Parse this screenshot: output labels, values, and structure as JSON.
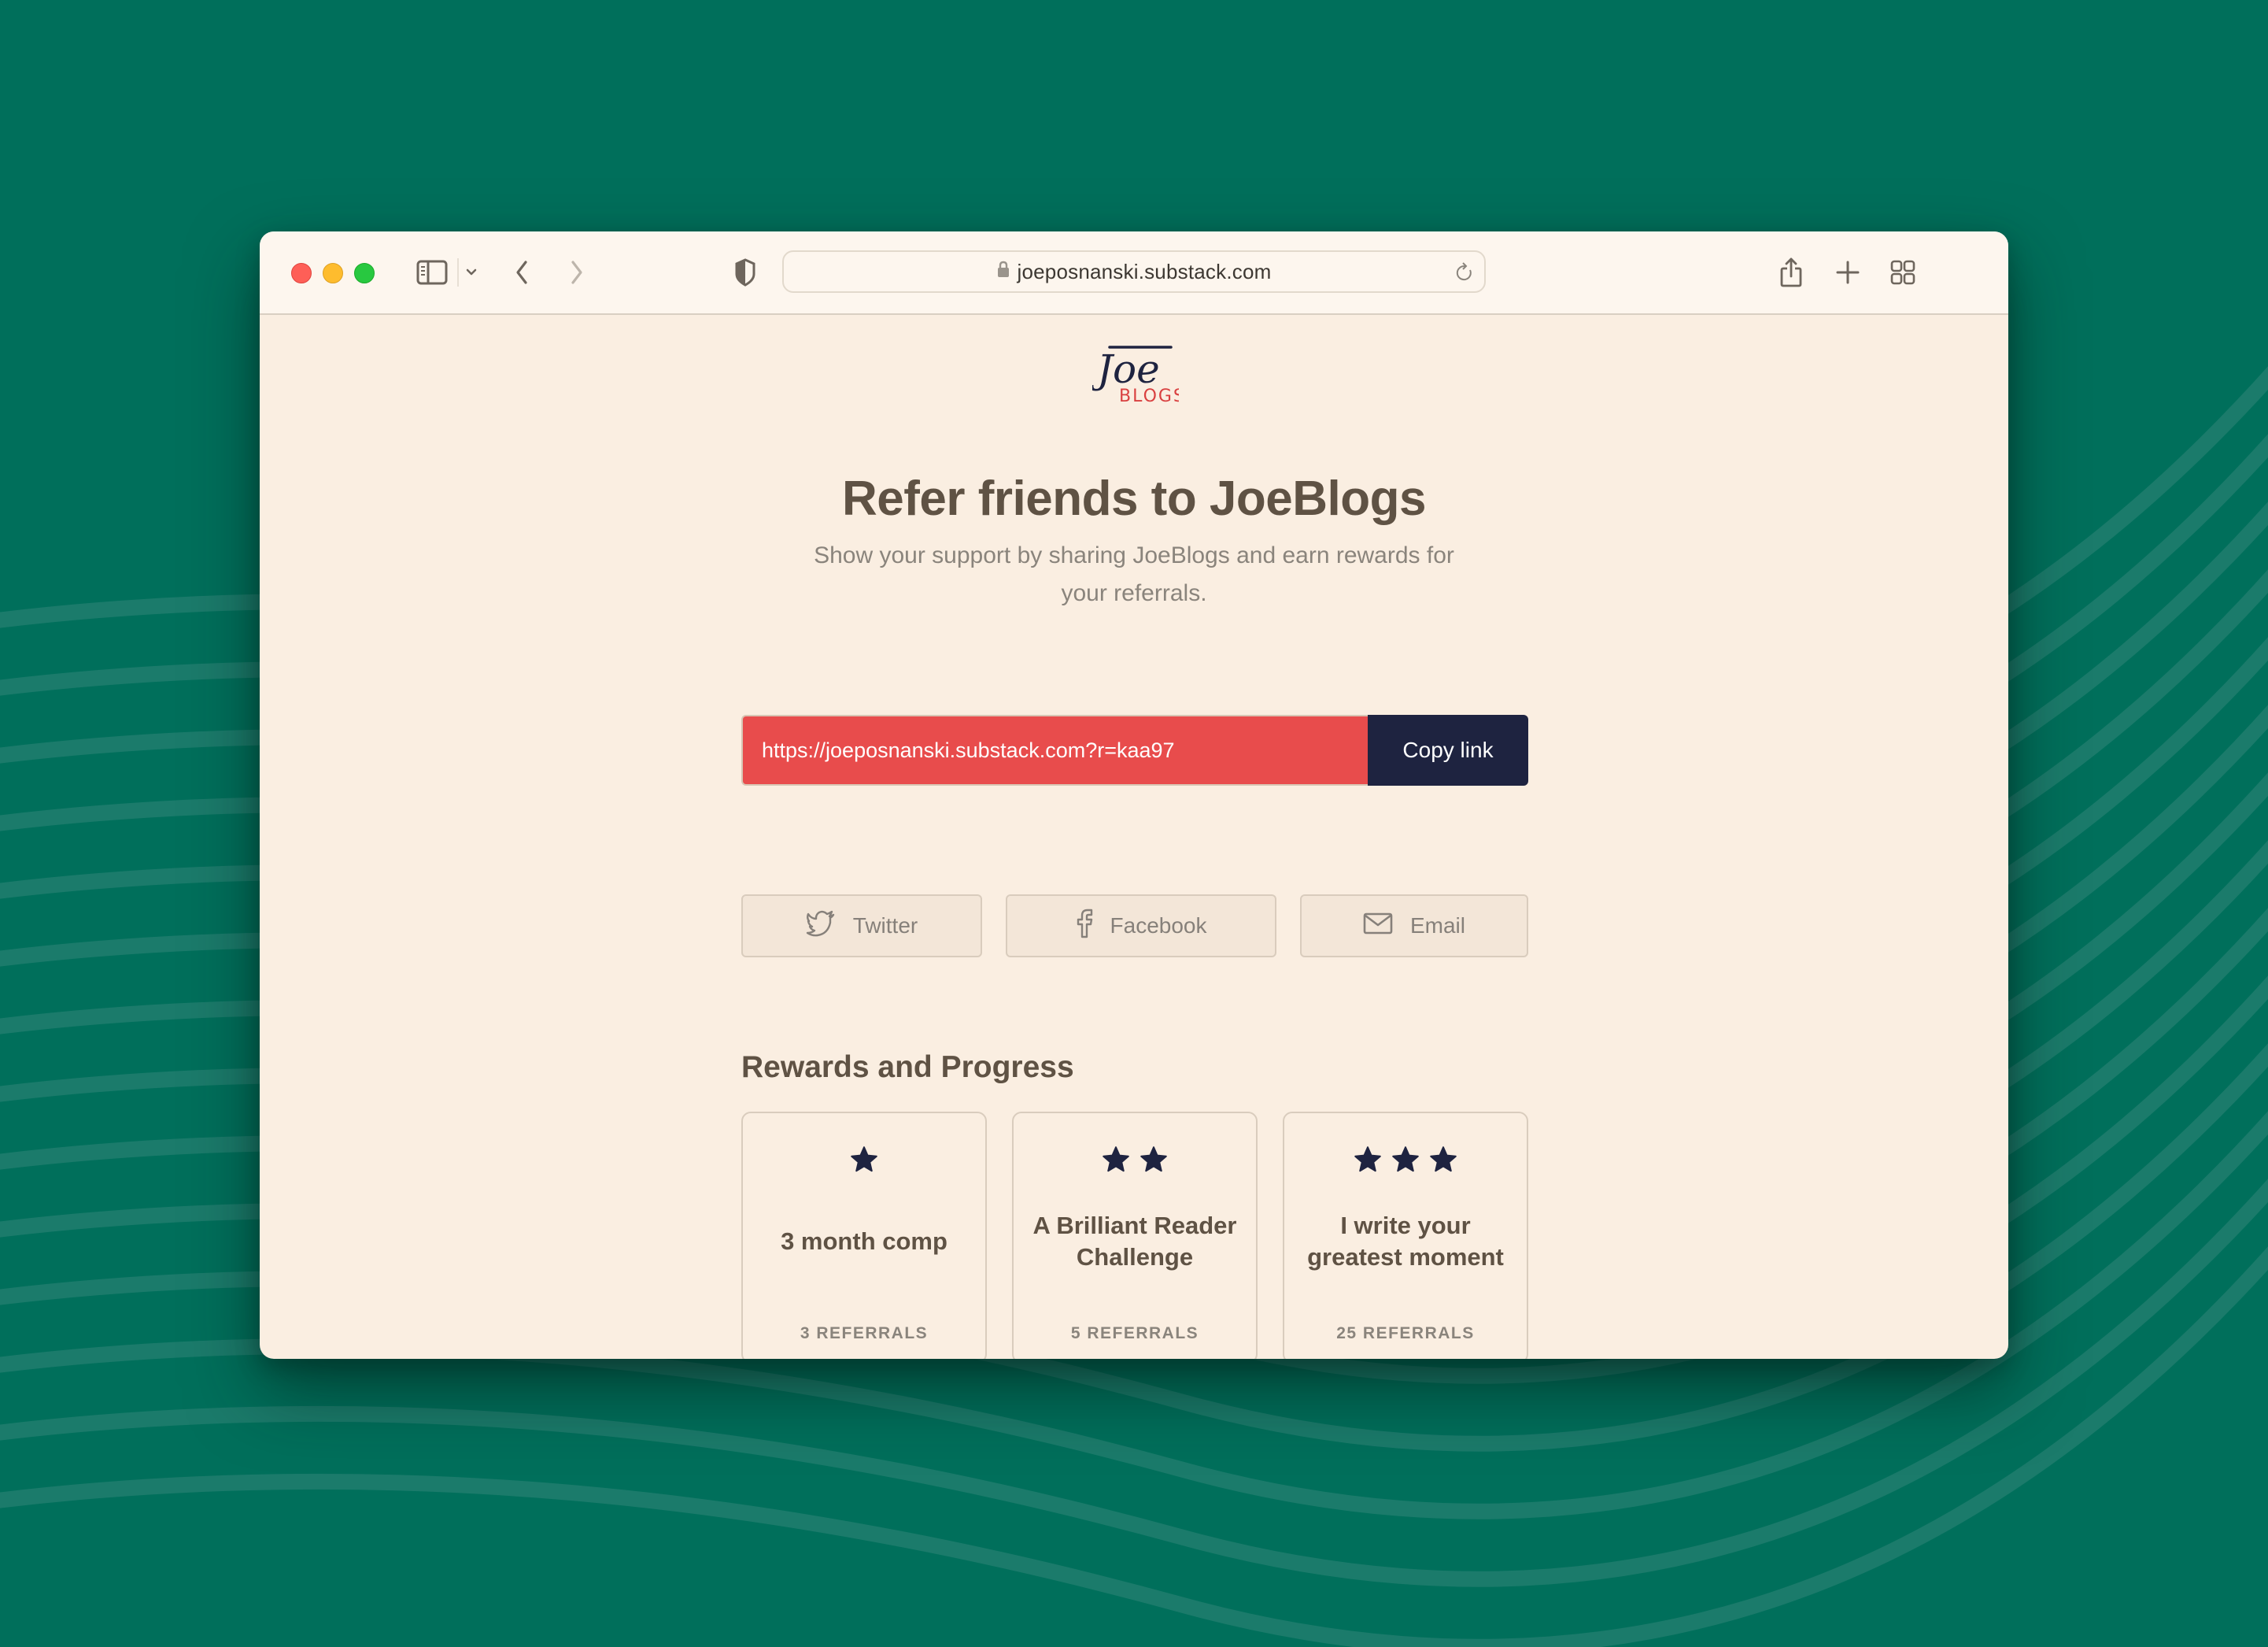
{
  "browser": {
    "url": "joeposnanski.substack.com",
    "traffic_lights": [
      "close",
      "minimize",
      "zoom"
    ],
    "toolbar_icons": [
      "sidebar-icon",
      "chevron-down-icon",
      "back-icon",
      "forward-icon",
      "privacy-shield-icon",
      "lock-icon",
      "reload-icon",
      "share-icon",
      "new-tab-icon",
      "tab-overview-icon"
    ]
  },
  "logo": {
    "primary": "Joe",
    "secondary": "BLOGS",
    "primary_color": "#1e2340",
    "secondary_color": "#d94040"
  },
  "page": {
    "title": "Refer friends to JoeBlogs",
    "subtitle": "Show your support by sharing JoeBlogs and earn rewards for your referrals."
  },
  "referral": {
    "link": "https://joeposnanski.substack.com?r=kaa97",
    "copy_label": "Copy link",
    "input_color": "#e84c4c",
    "button_color": "#1e2340"
  },
  "share": [
    {
      "label": "Twitter",
      "icon": "twitter-icon"
    },
    {
      "label": "Facebook",
      "icon": "facebook-icon"
    },
    {
      "label": "Email",
      "icon": "email-icon"
    }
  ],
  "rewards": {
    "title": "Rewards and Progress",
    "items": [
      {
        "stars": 1,
        "title": "3 month comp",
        "requirement": "3 REFERRALS"
      },
      {
        "stars": 2,
        "title": "A Brilliant Reader Challenge",
        "requirement": "5 REFERRALS"
      },
      {
        "stars": 3,
        "title": "I write your greatest moment",
        "requirement": "25 REFERRALS"
      }
    ],
    "star_color": "#1e2340"
  },
  "colors": {
    "background": "#006f5b",
    "wave_stripe": "#1b7b6b",
    "page_bg": "#faeee1",
    "toolbar_bg": "#fdf6ee",
    "heading_text": "#5f5244",
    "muted_text": "#8a847c"
  }
}
